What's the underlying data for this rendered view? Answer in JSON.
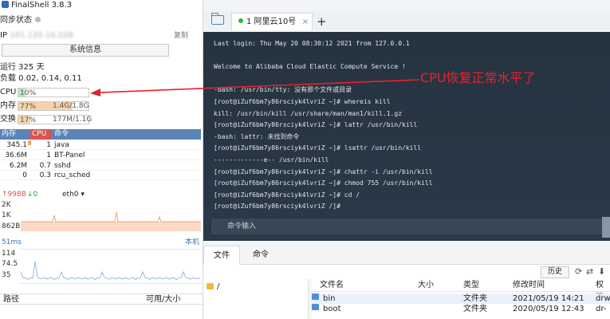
{
  "app": {
    "title": "FinalShell 3.8.3"
  },
  "left": {
    "sync_label": "同步状态",
    "ip_label": "IP",
    "ip_value": "101.133.10.228",
    "copy_label": "复制",
    "sysinfo_button": "系统信息",
    "uptime": "运行 325 天",
    "load": "负载 0.02, 0.14, 0.11",
    "cpu": {
      "label": "CPU",
      "value": "10%",
      "fraction": 0.1
    },
    "mem": {
      "label": "内存",
      "value": "77%",
      "detail": "1.4G/1.8G",
      "fraction": 0.77
    },
    "swap": {
      "label": "交换",
      "value": "17%",
      "detail": "177M/1.1G",
      "fraction": 0.17
    },
    "proc_headers": [
      "内存",
      "CPU",
      "命令"
    ],
    "processes": [
      {
        "mem": "345.1",
        "cpu": "1",
        "cmd": "java"
      },
      {
        "mem": "36.6M",
        "cpu": "1",
        "cmd": "BT-Panel"
      },
      {
        "mem": "6.2M",
        "cpu": "0.7",
        "cmd": "sshd"
      },
      {
        "mem": "0",
        "cpu": "0.3",
        "cmd": "rcu_sched"
      }
    ],
    "net": {
      "up": "↑998B",
      "down": "↓0",
      "iface": "eth0",
      "labels": [
        "2K",
        "1K",
        "862B"
      ]
    },
    "latency": {
      "label": "51ms",
      "target": "本机",
      "labels": [
        "114",
        "74.5",
        "35"
      ]
    },
    "path_headers": {
      "path": "路径",
      "avail": "可用/大小"
    }
  },
  "tabs": {
    "active_label": "1 阿里云10号"
  },
  "terminal": {
    "lines": [
      "Last login: Thu May 20 08:30:12 2021 from 127.0.0.1",
      "",
      "Welcome to Alibaba Cloud Elastic Compute Service !",
      "",
      "-bash: /usr/bin/tty: 没有那个文件或目录",
      "[root@iZuf6bm7y86rsciyk4lvriZ ~]# whereis kill",
      "kill: /usr/bin/kill /usr/share/man/man1/kill.1.gz",
      "[root@iZuf6bm7y86rsciyk4lvriZ ~]# lattr /usr/bin/kill",
      "-bash: lattr: 未找到命令",
      "[root@iZuf6bm7y86rsciyk4lvriZ ~]# lsattr /usr/bin/kill",
      "-------------e-- /usr/bin/kill",
      "[root@iZuf6bm7y86rsciyk4lvriZ ~]# chattr -i /usr/bin/kill",
      "[root@iZuf6bm7y86rsciyk4lvriZ ~]# chmod 755 /usr/bin/kill",
      "[root@iZuf6bm7y86rsciyk4lvriZ ~]# cd /",
      "[root@iZuf6bm7y86rsciyk4lvriZ /]#"
    ],
    "annotation": "CPU恢复正常水平了",
    "command_placeholder": "命令输入"
  },
  "bottom": {
    "tab_file": "文件",
    "tab_cmd": "命令",
    "history": "历史",
    "tree_root": "/",
    "headers": {
      "name": "文件名",
      "size": "大小",
      "type": "类型",
      "mtime": "修改时间",
      "perm": "权限"
    },
    "files": [
      {
        "name": "bin",
        "type": "文件夹",
        "mtime": "2021/05/19 14:21",
        "perm": "drw"
      },
      {
        "name": "boot",
        "type": "文件夹",
        "mtime": "2020/05/19 12:43",
        "perm": "dr-"
      }
    ]
  }
}
